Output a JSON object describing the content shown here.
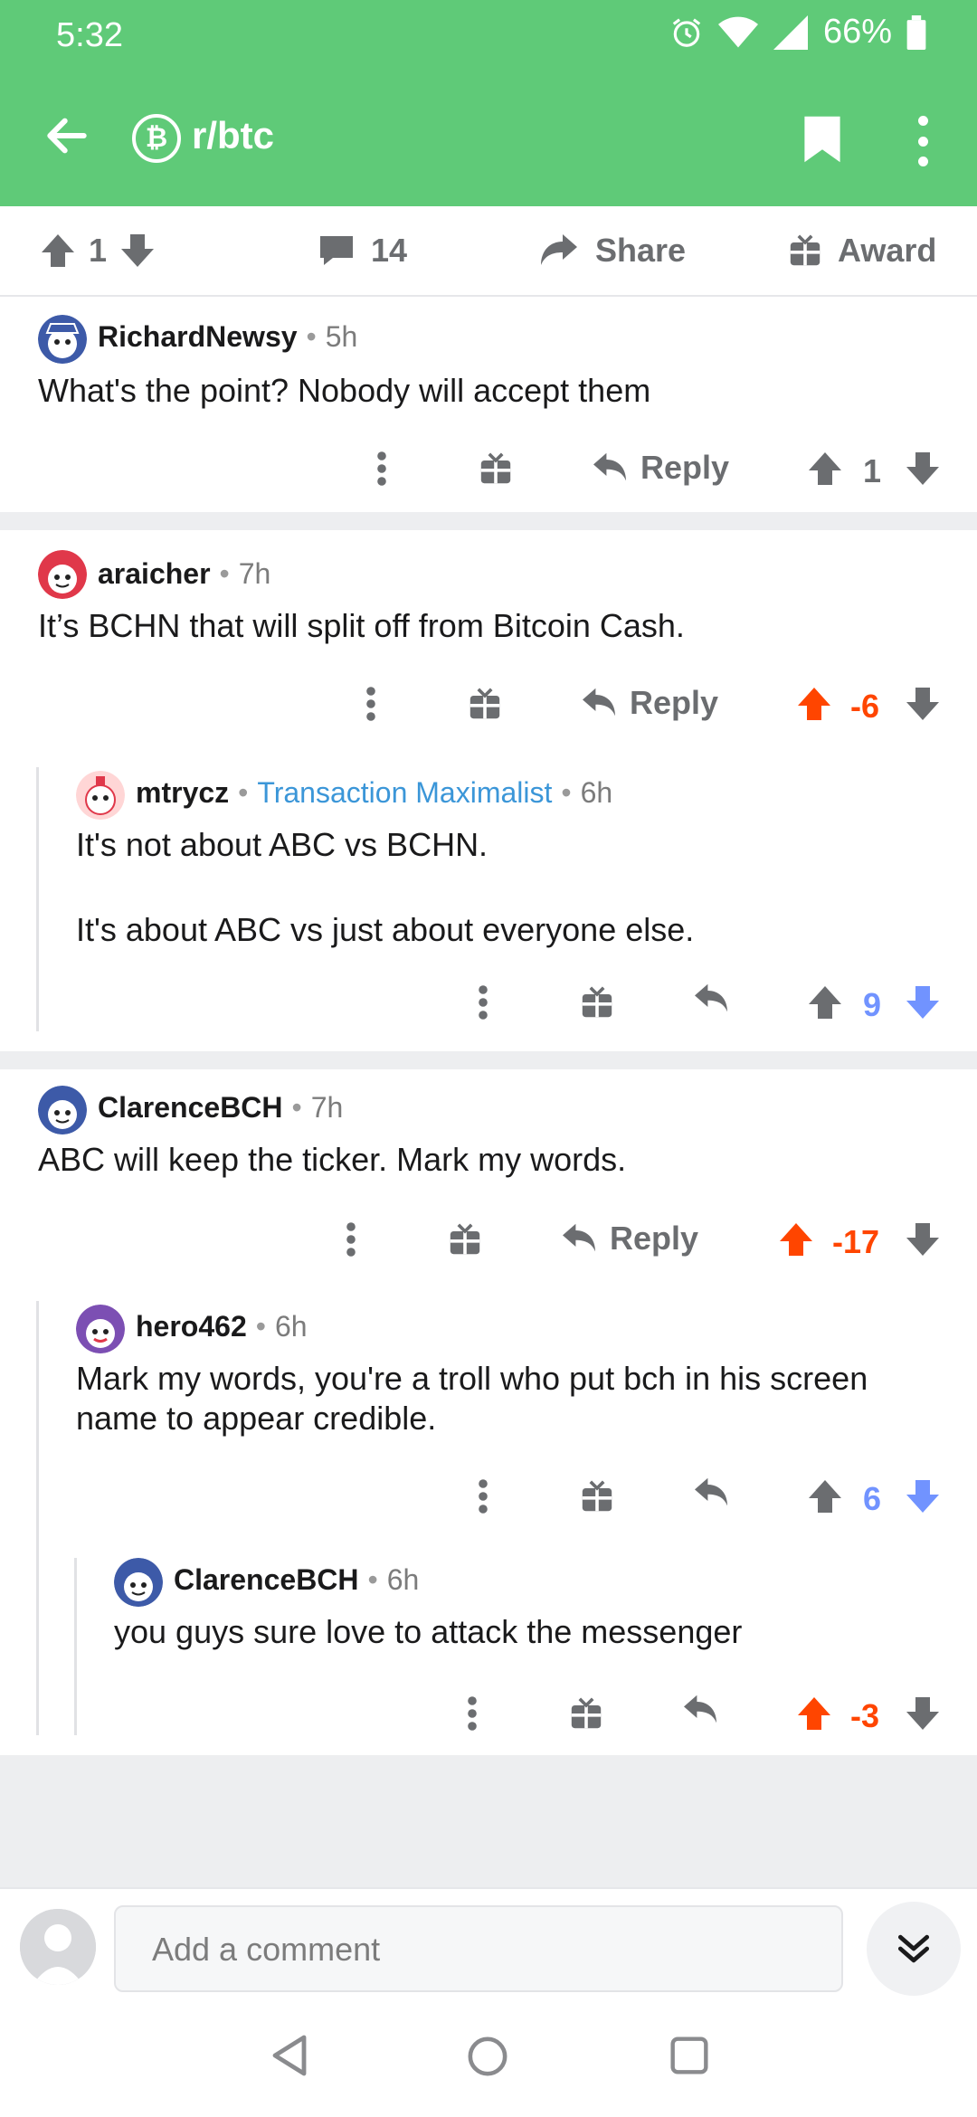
{
  "status_bar": {
    "time": "5:32",
    "battery": "66%"
  },
  "app_bar": {
    "subreddit": "r/btc"
  },
  "post_bar": {
    "upvotes": "1",
    "comments": "14",
    "share_label": "Share",
    "award_label": "Award"
  },
  "comments": [
    {
      "user": "RichardNewsy",
      "time": "5h",
      "text": "What's the point? Nobody will accept them",
      "reply_label": "Reply",
      "score": "1",
      "vote": "none"
    },
    {
      "user": "araicher",
      "time": "7h",
      "text": "It’s BCHN that will split off from Bitcoin Cash.",
      "reply_label": "Reply",
      "score": "-6",
      "vote": "up"
    },
    {
      "user": "mtrycz",
      "flair": "Transaction Maximalist",
      "time": "6h",
      "text_line1": "It's not about ABC vs BCHN.",
      "text_line2": "It's about ABC vs just about everyone else.",
      "score": "9",
      "vote": "down"
    },
    {
      "user": "ClarenceBCH",
      "time": "7h",
      "text": "ABC will keep the ticker. Mark my words.",
      "reply_label": "Reply",
      "score": "-17",
      "vote": "up"
    },
    {
      "user": "hero462",
      "time": "6h",
      "text_line1": "Mark my words, you're a troll who put bch in his screen",
      "text_line2": "name to appear credible.",
      "score": "6",
      "vote": "down"
    },
    {
      "user": "ClarenceBCH",
      "time": "6h",
      "text": "you guys sure love to attack the messenger",
      "score": "-3",
      "vote": "up"
    }
  ],
  "composer": {
    "placeholder": "Add a comment"
  },
  "colors": {
    "brand": "#5fca78",
    "upvote": "#ff4500",
    "downvote": "#7193ff",
    "flair": "#3b96d8"
  }
}
